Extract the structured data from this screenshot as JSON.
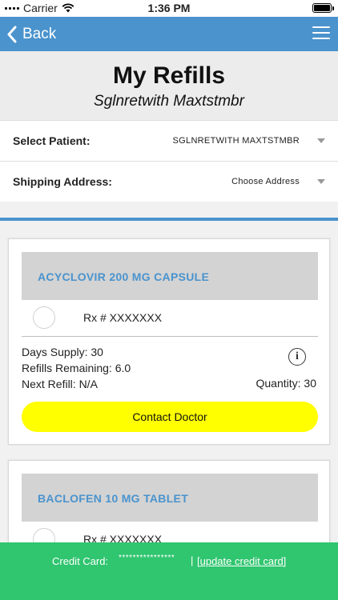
{
  "status_bar": {
    "carrier": "Carrier",
    "time": "1:36 PM"
  },
  "nav": {
    "back_label": "Back",
    "menu_icon": "hamburger-menu-icon"
  },
  "header": {
    "title": "My Refills",
    "subtitle": "Sglnretwith Maxtstmbr"
  },
  "form": {
    "patient_label": "Select Patient:",
    "patient_value": "SGLNRETWITH MAXTSTMBR",
    "address_label": "Shipping Address:",
    "address_value": "Choose Address"
  },
  "refills": [
    {
      "drug_name": "ACYCLOVIR 200 MG CAPSULE",
      "rx": "Rx # XXXXXXX",
      "days_supply": "Days Supply: 30",
      "refills_remaining": "Refills Remaining: 6.0",
      "next_refill": "Next Refill: N/A",
      "quantity": "Quantity: 30",
      "action_label": "Contact Doctor"
    },
    {
      "drug_name": "BACLOFEN 10 MG TABLET",
      "rx": "Rx # XXXXXXX"
    }
  ],
  "footer": {
    "credit_card_label": "Credit Card:",
    "credit_card_mask": "****************",
    "separator": "|",
    "update_link": "[update credit card]"
  },
  "colors": {
    "nav_blue": "#4a93cd",
    "footer_green": "#30c56f",
    "button_yellow": "#ffff00"
  }
}
